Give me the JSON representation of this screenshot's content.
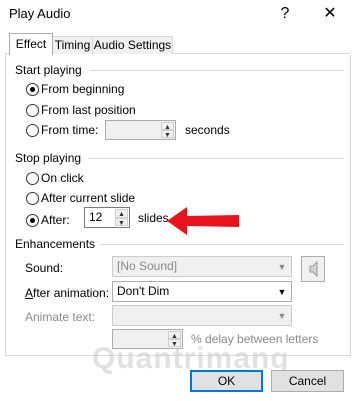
{
  "window": {
    "title": "Play Audio",
    "help_glyph": "?",
    "close_glyph": "✕"
  },
  "tabs": [
    {
      "label": "Effect",
      "active": true
    },
    {
      "label": "Timing",
      "active": false
    },
    {
      "label": "Audio Settings",
      "active": false
    }
  ],
  "start_playing": {
    "heading": "Start playing",
    "options": [
      {
        "label": "From beginning",
        "checked": true
      },
      {
        "label": "From last position",
        "checked": false
      },
      {
        "label": "From time:",
        "checked": false
      }
    ],
    "time_value": "",
    "time_unit": "seconds"
  },
  "stop_playing": {
    "heading": "Stop playing",
    "options": [
      {
        "label": "On click",
        "checked": false
      },
      {
        "label": "After current slide",
        "checked": false
      },
      {
        "label": "After:",
        "checked": true
      }
    ],
    "after_value": "12",
    "after_unit": "slides",
    "arrow_color": "#e8141b"
  },
  "enhancements": {
    "heading": "Enhancements",
    "sound_label": "Sound:",
    "sound_value": "[No Sound]",
    "after_animation_label": "After animation:",
    "after_animation_value": "Don't Dim",
    "animate_text_label": "Animate text:",
    "animate_text_value": "",
    "delay_value": "",
    "delay_suffix": "% delay between letters",
    "speaker_icon": "speaker-icon"
  },
  "buttons": {
    "ok": "OK",
    "cancel": "Cancel"
  },
  "watermark": "Quantrimang"
}
